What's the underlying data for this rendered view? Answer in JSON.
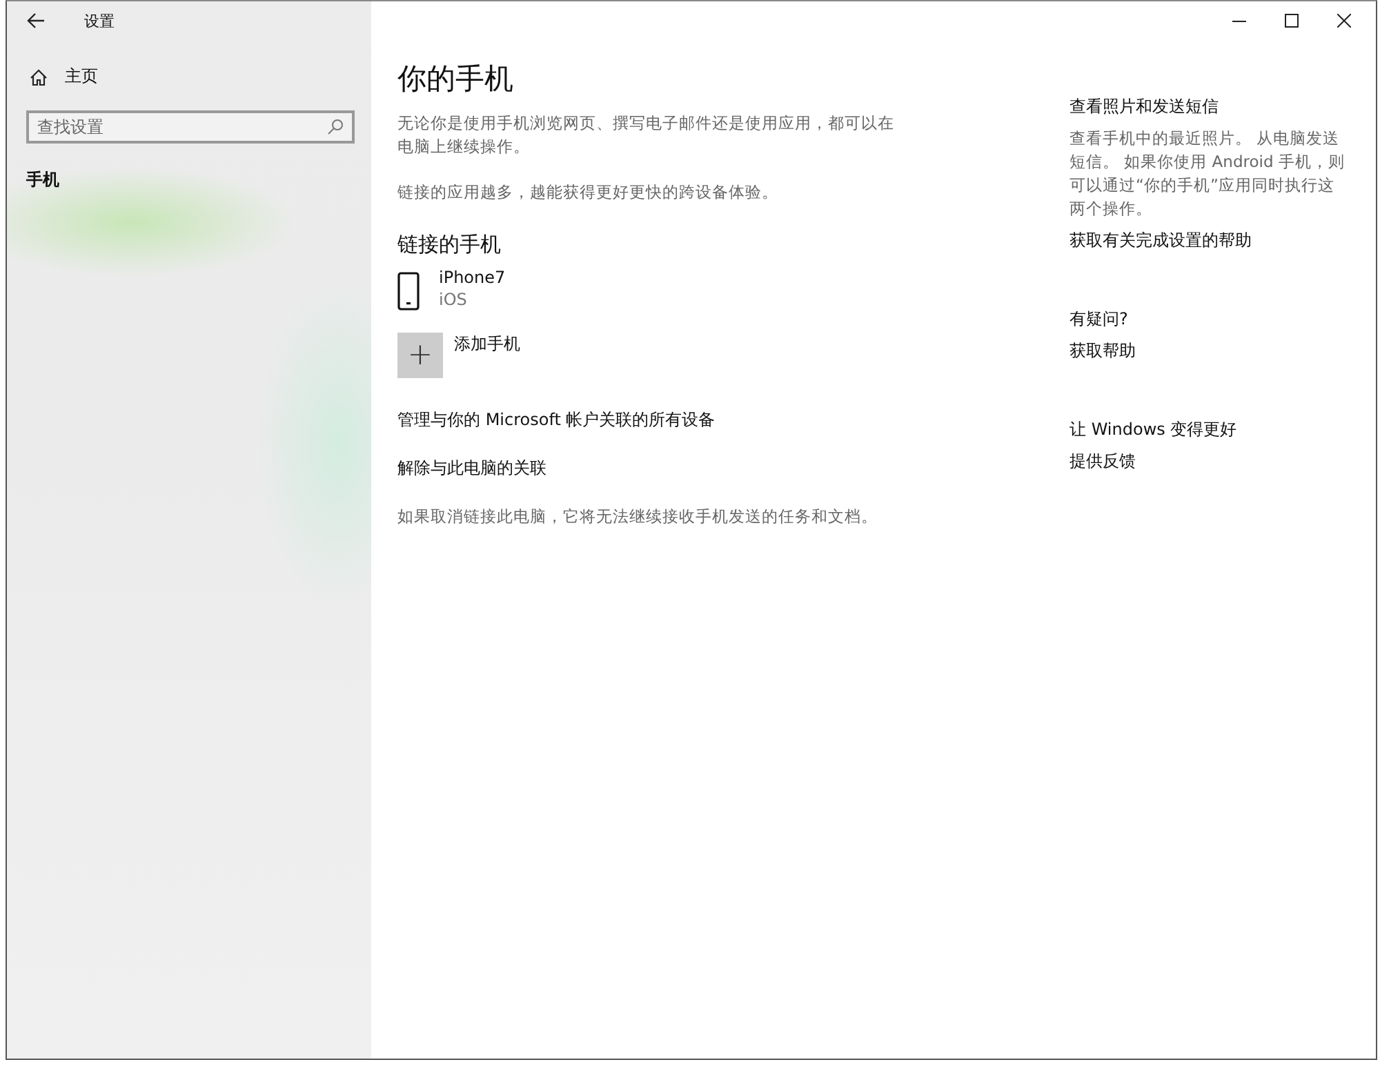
{
  "window": {
    "title": "设置"
  },
  "sidebar": {
    "home": "主页",
    "search": {
      "placeholder": "查找设置"
    },
    "items": [
      {
        "label": "手机",
        "selected": true
      }
    ]
  },
  "main": {
    "title": "你的手机",
    "intro": [
      "无论你是使用手机浏览网页、撰写电子邮件还是使用应用，都可以在电脑上继续操作。",
      "链接的应用越多，越能获得更好更快的跨设备体验。"
    ],
    "linked_heading": "链接的手机",
    "devices": [
      {
        "name": "iPhone7",
        "os": "iOS"
      }
    ],
    "add_phone": {
      "icon": "+",
      "label": "添加手机"
    },
    "links": [
      "管理与你的 Microsoft 帐户关联的所有设备",
      "解除与此电脑的关联"
    ],
    "note": "如果取消链接此电脑，它将无法继续接收手机发送的任务和文档。"
  },
  "aside": [
    {
      "heading": "查看照片和发送短信",
      "text": "查看手机中的最近照片。 从电脑发送短信。 如果你使用 Android 手机，则可以通过“你的手机”应用同时执行这两个操作。",
      "link": "获取有关完成设置的帮助"
    },
    {
      "heading": "有疑问?",
      "link": "获取帮助"
    },
    {
      "heading": "让 Windows 变得更好",
      "link": "提供反馈"
    }
  ]
}
